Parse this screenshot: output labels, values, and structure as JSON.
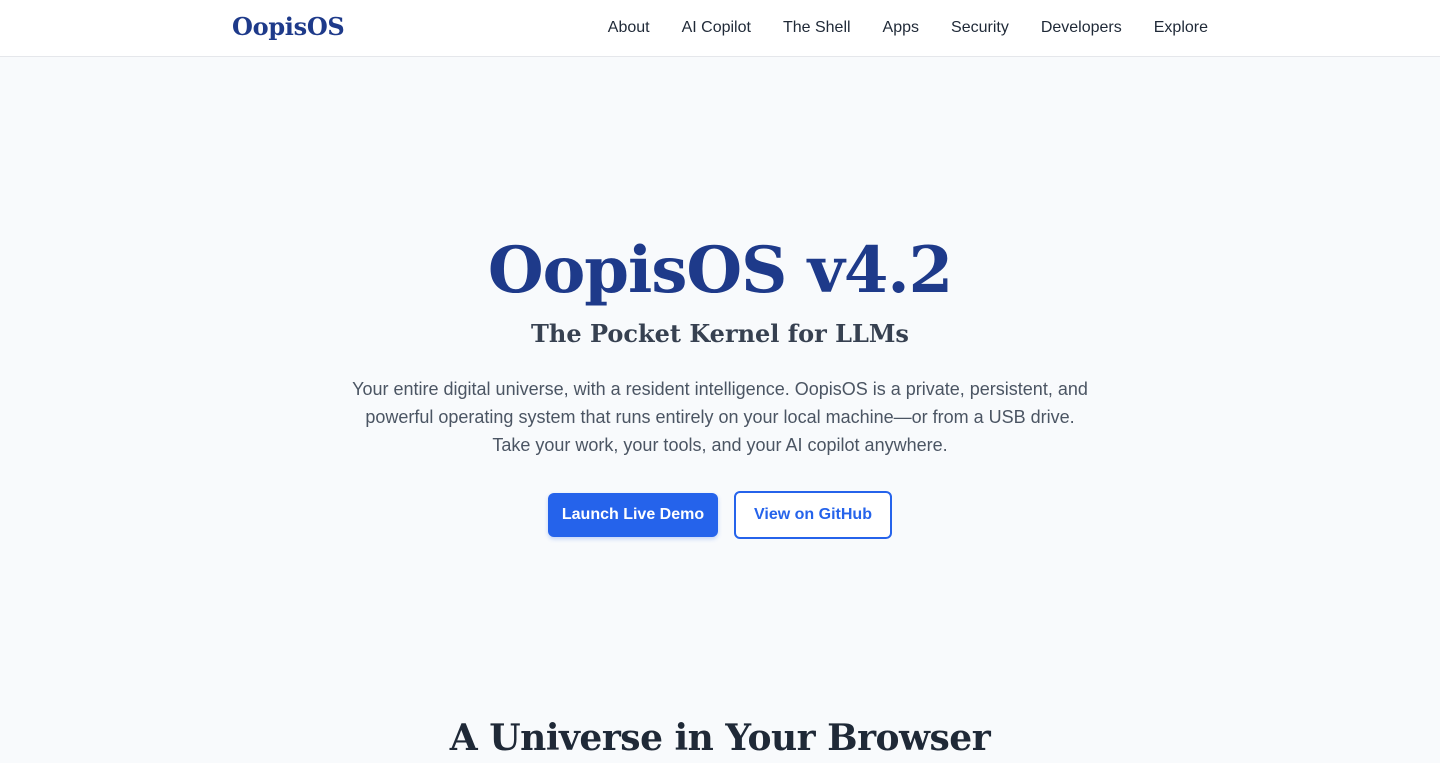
{
  "header": {
    "brand": "OopisOS",
    "nav": [
      {
        "label": "About"
      },
      {
        "label": "AI Copilot"
      },
      {
        "label": "The Shell"
      },
      {
        "label": "Apps"
      },
      {
        "label": "Security"
      },
      {
        "label": "Developers"
      },
      {
        "label": "Explore"
      }
    ]
  },
  "hero": {
    "title": "OopisOS v4.2",
    "subtitle": "The Pocket Kernel for LLMs",
    "description": "Your entire digital universe, with a resident intelligence. OopisOS is a private, persistent, and powerful operating system that runs entirely on your local machine—or from a USB drive. Take your work, your tools, and your AI copilot anywhere.",
    "primary_button": "Launch Live Demo",
    "secondary_button": "View on GitHub"
  },
  "section": {
    "title": "A Universe in Your Browser"
  },
  "colors": {
    "brand": "#1e3a8a",
    "accent": "#2563eb",
    "background": "#f8fafc"
  }
}
